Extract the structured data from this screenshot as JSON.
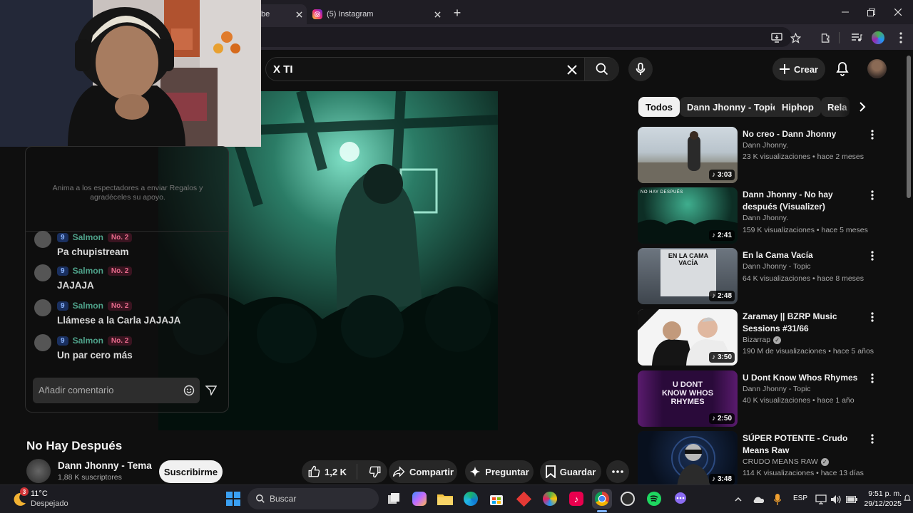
{
  "browser": {
    "tabs": [
      {
        "title": "be",
        "active": true
      },
      {
        "title": "(5) Instagram",
        "active": false
      }
    ],
    "new_tab_label": "+"
  },
  "youtube": {
    "search_value": "X TI",
    "create_label": "Crear",
    "chips": [
      "Todos",
      "Dann Jhonny - Topic",
      "Hiphop",
      "Rela"
    ],
    "video_title": "No Hay Después",
    "channel_name": "Dann Jhonny - Tema",
    "subscribers": "1,88 K suscriptores",
    "subscribe_label": "Suscribirme",
    "likes": "1,2 K",
    "share_label": "Compartir",
    "ask_label": "Preguntar",
    "save_label": "Guardar"
  },
  "chat": {
    "gift_prompt": "Anima a los espectadores a enviar Regalos y agradéceles su apoyo.",
    "messages": [
      {
        "level": "9",
        "user": "Salmon",
        "badge": "No. 2",
        "text": "Pa chupistream"
      },
      {
        "level": "9",
        "user": "Salmon",
        "badge": "No. 2",
        "text": "JAJAJA"
      },
      {
        "level": "9",
        "user": "Salmon",
        "badge": "No. 2",
        "text": "Llámese a la Carla JAJAJA"
      },
      {
        "level": "9",
        "user": "Salmon",
        "badge": "No. 2",
        "text": "Un par cero más"
      }
    ],
    "comment_placeholder": "Añadir comentario"
  },
  "recommendations": [
    {
      "title": "No creo - Dann Jhonny",
      "channel": "Dann Jhonny.",
      "meta": "23 K visualizaciones • hace 2 meses",
      "duration": "3:03",
      "verified": false
    },
    {
      "title": "Dann Jhonny - No hay después (Visualizer)",
      "channel": "Dann Jhonny.",
      "meta": "159 K visualizaciones • hace 5 meses",
      "duration": "2:41",
      "verified": false,
      "thumb_text": "NO HAY DESPUÉS"
    },
    {
      "title": "En la Cama Vacía",
      "channel": "Dann Jhonny - Topic",
      "meta": "64 K visualizaciones • hace 8 meses",
      "duration": "2:48",
      "verified": false,
      "thumb_text": "EN LA CAMA VACÍA"
    },
    {
      "title": "Zaramay || BZRP Music Sessions #31/66",
      "channel": "Bizarrap",
      "meta": "190 M de visualizaciones • hace 5 años",
      "duration": "3:50",
      "verified": true
    },
    {
      "title": "U Dont Know Whos Rhymes",
      "channel": "Dann Jhonny - Topic",
      "meta": "40 K visualizaciones • hace 1 año",
      "duration": "2:50",
      "verified": false,
      "thumb_text": "U DONT KNOW WHOS RHYMES"
    },
    {
      "title": "SÚPER POTENTE - Crudo Means Raw",
      "channel": "CRUDO MEANS RAW",
      "meta": "114 K visualizaciones • hace 13 días",
      "duration": "3:48",
      "verified": true
    }
  ],
  "taskbar": {
    "weather_temp": "11°C",
    "weather_desc": "Despejado",
    "weather_badge": "3",
    "search_placeholder": "Buscar",
    "lang": "ESP",
    "time": "9:51 p. m.",
    "date": "29/12/2025"
  },
  "colors": {
    "accent_teal": "#2e8b72",
    "youtube_bg": "#0f0f0f",
    "chip_selected": "#f1f1f1"
  }
}
